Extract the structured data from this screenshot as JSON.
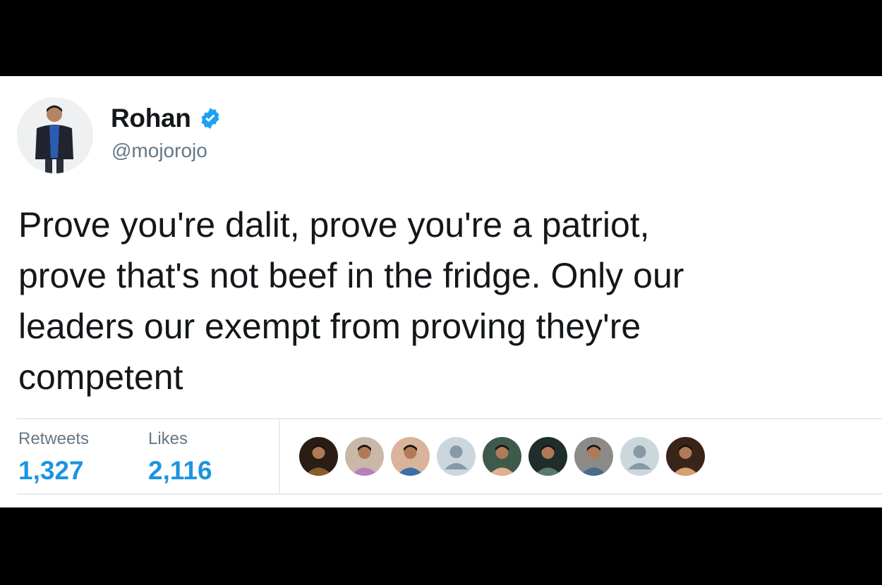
{
  "tweet": {
    "display_name": "Rohan",
    "handle": "@mojorojo",
    "verified": true,
    "text": "Prove you're dalit, prove you're a patriot,\nprove that's not beef in the fridge. Only our\nleaders our exempt from proving they're\ncompetent"
  },
  "stats": {
    "retweets_label": "Retweets",
    "retweets_value": "1,327",
    "likes_label": "Likes",
    "likes_value": "2,116"
  },
  "likers": [
    {
      "kind": "photo",
      "bg": "#2a1e14",
      "fg": "#8a5a30"
    },
    {
      "kind": "photo",
      "bg": "#c9b8a8",
      "fg": "#b87fbf"
    },
    {
      "kind": "photo",
      "bg": "#d9b49a",
      "fg": "#3a6fa8"
    },
    {
      "kind": "default",
      "bg": "#ccd6dd",
      "fg": "#8899a6"
    },
    {
      "kind": "photo",
      "bg": "#3e5a4a",
      "fg": "#e0b090"
    },
    {
      "kind": "photo",
      "bg": "#1f2e2a",
      "fg": "#5a7a6a"
    },
    {
      "kind": "photo",
      "bg": "#8c8a88",
      "fg": "#4a6a8c"
    },
    {
      "kind": "default",
      "bg": "#ccd6dd",
      "fg": "#8899a6"
    },
    {
      "kind": "photo",
      "bg": "#3a2418",
      "fg": "#d8a070"
    }
  ],
  "colors": {
    "accent": "#1b95e0",
    "verified": "#1da1f2",
    "text": "#14171a",
    "secondary": "#657786"
  }
}
